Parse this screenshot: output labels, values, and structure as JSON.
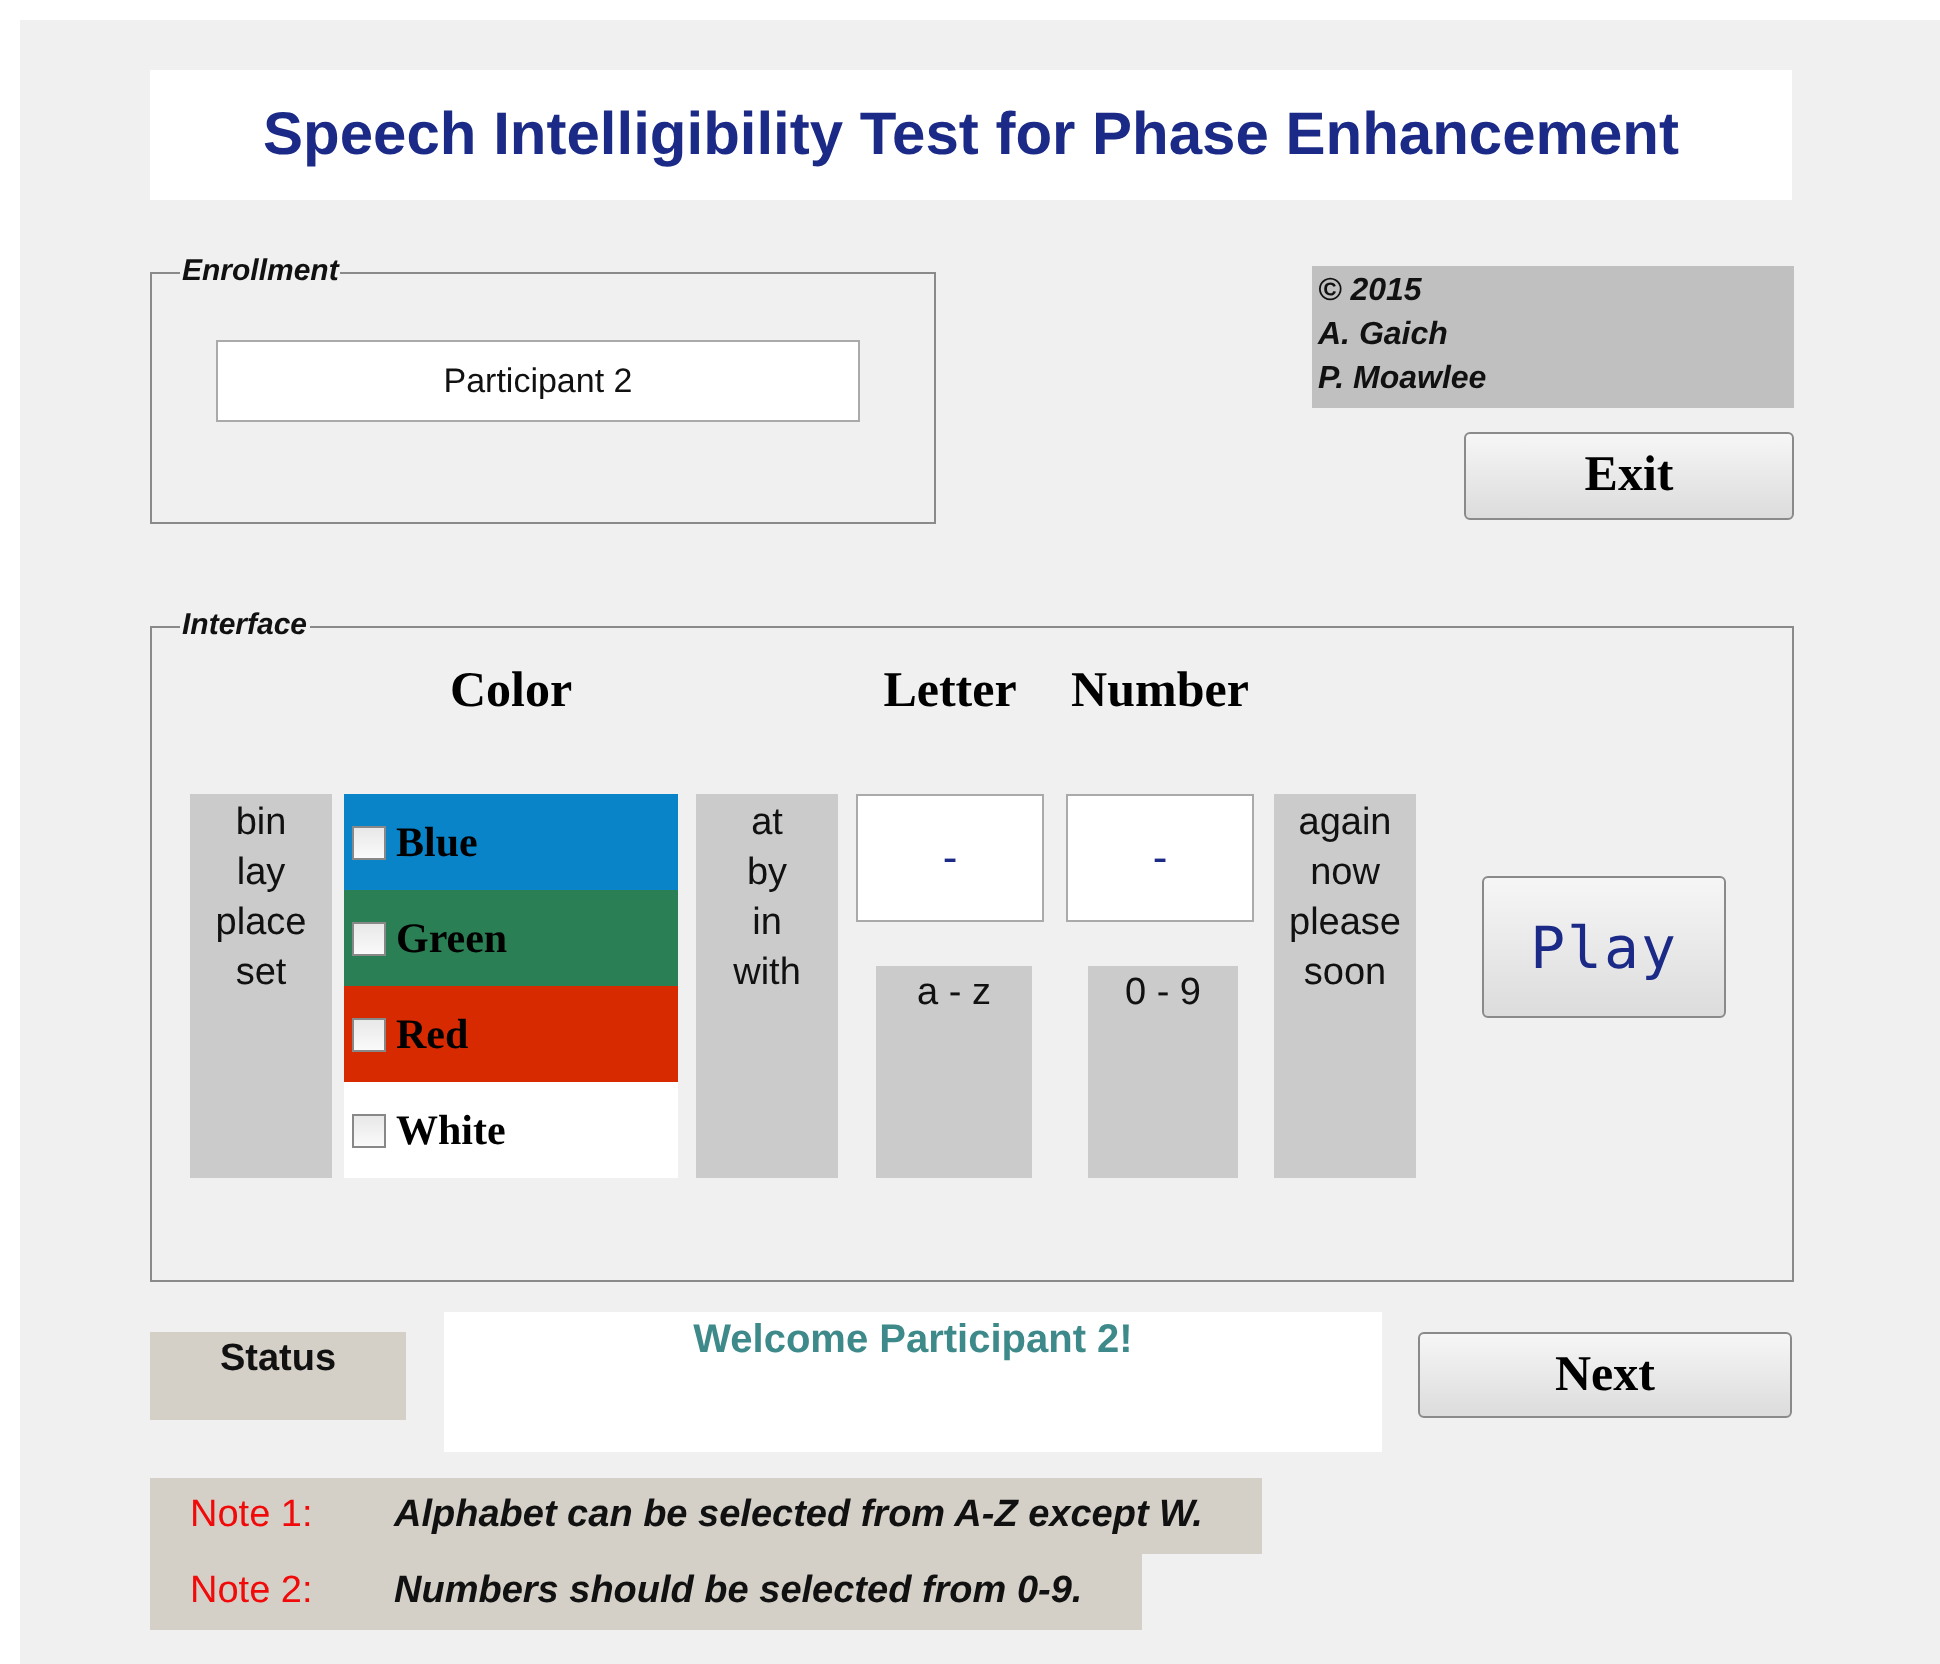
{
  "title": "Speech Intelligibility Test for Phase Enhancement",
  "enrollment": {
    "label": "Enrollment",
    "value": "Participant 2"
  },
  "credits": [
    "© 2015",
    "A. Gaich",
    "P. Moawlee"
  ],
  "exit_button": "Exit",
  "interface": {
    "label": "Interface",
    "commands": [
      "bin",
      "lay",
      "place",
      "set"
    ],
    "color_header": "Color",
    "colors": [
      {
        "label": "Blue",
        "color": "#0a84c8",
        "checked": false
      },
      {
        "label": "Green",
        "color": "#2a7f55",
        "checked": false
      },
      {
        "label": "Red",
        "color": "#d82a00",
        "checked": false
      },
      {
        "label": "White",
        "color": "#ffffff",
        "checked": false
      }
    ],
    "prepositions": [
      "at",
      "by",
      "in",
      "with"
    ],
    "letter": {
      "header": "Letter",
      "value": "-",
      "hint": "a - z"
    },
    "number": {
      "header": "Number",
      "value": "-",
      "hint": "0 - 9"
    },
    "adverbs": [
      "again",
      "now",
      "please",
      "soon"
    ],
    "play_button": "Play"
  },
  "status": {
    "label": "Status",
    "message": "Welcome Participant 2!"
  },
  "next_button": "Next",
  "notes": [
    {
      "label": "Note 1:",
      "text": "Alphabet can be selected from A-Z except W."
    },
    {
      "label": "Note 2:",
      "text": "Numbers should be selected from 0-9."
    }
  ]
}
